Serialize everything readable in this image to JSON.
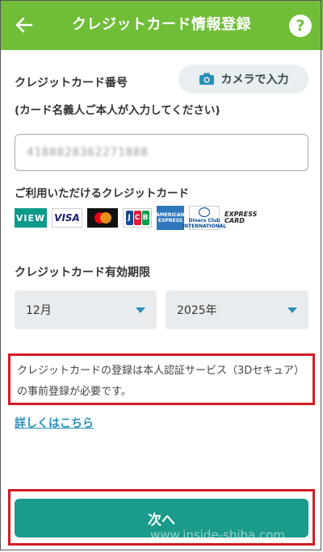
{
  "header": {
    "title": "クレジットカード情報登録",
    "help_label": "?",
    "color": "#70bd37"
  },
  "card_number": {
    "label": "クレジットカード番号",
    "camera_button": "カメラで入力",
    "note": "(カード名義人ご本人が入力してください)",
    "value": "4180828362271888"
  },
  "brands": {
    "label": "ご利用いただけるクレジットカード",
    "items": [
      {
        "name": "view",
        "text": "VIEW"
      },
      {
        "name": "visa",
        "text": "VISA"
      },
      {
        "name": "mastercard",
        "text": ""
      },
      {
        "name": "jcb",
        "text": "JCB"
      },
      {
        "name": "amex",
        "text": "AMERICAN EXPRESS"
      },
      {
        "name": "diners",
        "text": "Diners Club INTERNATIONAL"
      },
      {
        "name": "express",
        "text": "EXPRESS CARD"
      }
    ]
  },
  "expiry": {
    "label": "クレジットカード有効期限",
    "month": "12月",
    "year": "2025年"
  },
  "notice": {
    "text": "クレジットカードの登録は本人認証サービス（3Dセキュア）の事前登録が必要です。",
    "border_color": "#d31c24"
  },
  "details_link": "詳しくはこちら",
  "next_button": "次へ",
  "watermark": "www.inside-shiba.com",
  "accent_color": "#1a9b8b"
}
